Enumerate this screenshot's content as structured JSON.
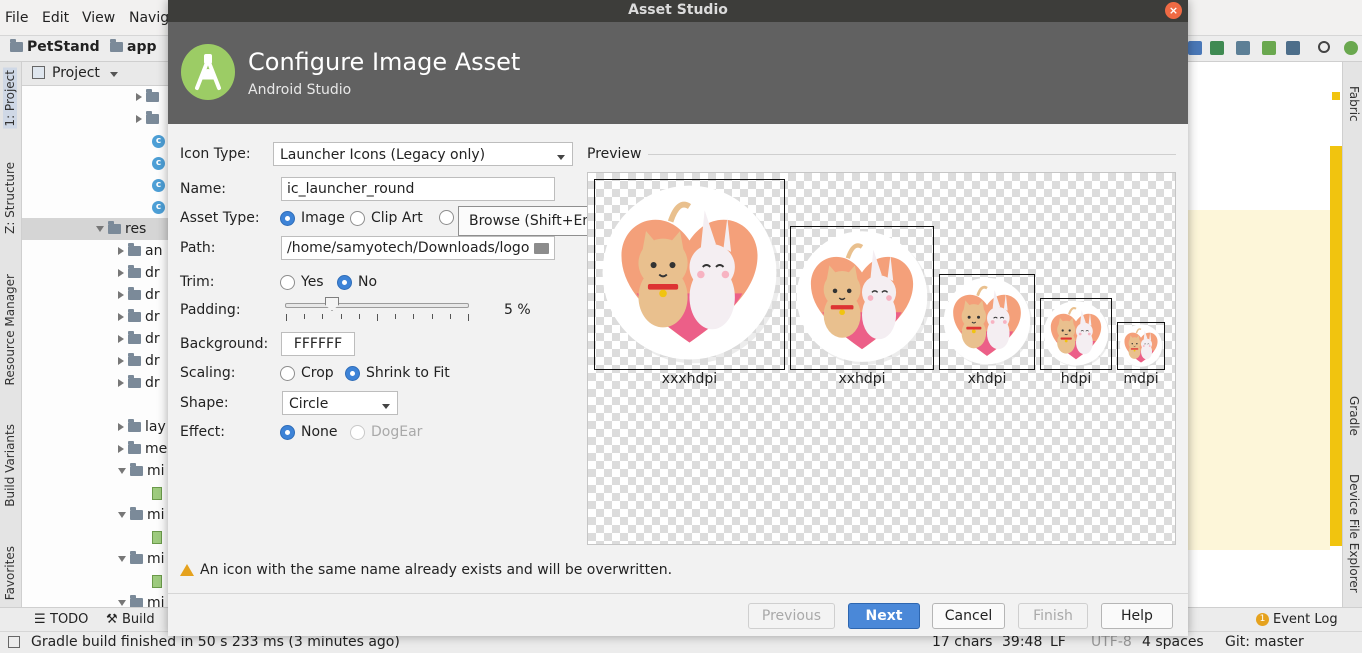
{
  "ide": {
    "menus": [
      "File",
      "Edit",
      "View",
      "Navig"
    ],
    "breadcrumbs": [
      "PetStand",
      "app"
    ],
    "project_label": "Project",
    "left_tabs": [
      "1: Project",
      "Z: Structure",
      "Resource Manager",
      "Build Variants",
      "Favorites"
    ],
    "right_tabs": [
      "Fabric",
      "Gradle",
      "Device File Explorer"
    ],
    "tree": {
      "res_label": "res",
      "items": [
        "an",
        "dr",
        "dr",
        "dr",
        "dr",
        "dr",
        "dr",
        "lay",
        "me",
        "mi",
        "mi",
        "mi",
        "mi"
      ]
    },
    "bottom_tools": {
      "todo": "TODO",
      "build": "Build",
      "event_log": "Event Log",
      "event_count": "1"
    },
    "status": {
      "message": "Gradle build finished in 50 s 233 ms (3 minutes ago)",
      "chars": "17 chars",
      "position": "39:48",
      "line_ending": "LF",
      "encoding": "UTF-8",
      "indent": "4 spaces",
      "git": "Git: master"
    }
  },
  "dialog": {
    "window_title": "Asset Studio",
    "close_icon": "×",
    "header_title": "Configure Image Asset",
    "header_subtitle": "Android Studio",
    "form": {
      "icon_type_label": "Icon Type:",
      "icon_type_value": "Launcher Icons (Legacy only)",
      "name_label": "Name:",
      "name_value": "ic_launcher_round",
      "asset_type_label": "Asset Type:",
      "asset_type_options": [
        "Image",
        "Clip Art"
      ],
      "asset_type_selected": "Image",
      "path_label": "Path:",
      "path_value": "/home/samyotech/Downloads/logo",
      "tooltip": "Browse (Shift+Enter)",
      "trim_label": "Trim:",
      "trim_yes": "Yes",
      "trim_no": "No",
      "trim_selected": "No",
      "padding_label": "Padding:",
      "padding_value": "5 %",
      "padding_level_percent": 5,
      "background_label": "Background:",
      "background_value": "FFFFFF",
      "scaling_label": "Scaling:",
      "scaling_crop": "Crop",
      "scaling_shrink": "Shrink to Fit",
      "scaling_selected": "Shrink to Fit",
      "shape_label": "Shape:",
      "shape_value": "Circle",
      "effect_label": "Effect:",
      "effect_none": "None",
      "effect_dogear": "DogEar",
      "effect_selected": "None"
    },
    "preview": {
      "label": "Preview",
      "densities": [
        "xxxhdpi",
        "xxhdpi",
        "xhdpi",
        "hdpi",
        "mdpi"
      ]
    },
    "warning": "An icon with the same name already exists and will be overwritten.",
    "buttons": {
      "previous": "Previous",
      "next": "Next",
      "cancel": "Cancel",
      "finish": "Finish",
      "help": "Help"
    },
    "colors": {
      "header_bg": "#616161",
      "accent": "#3d83d7",
      "warning": "#e5a21e",
      "android_green": "#9ccc65"
    }
  }
}
